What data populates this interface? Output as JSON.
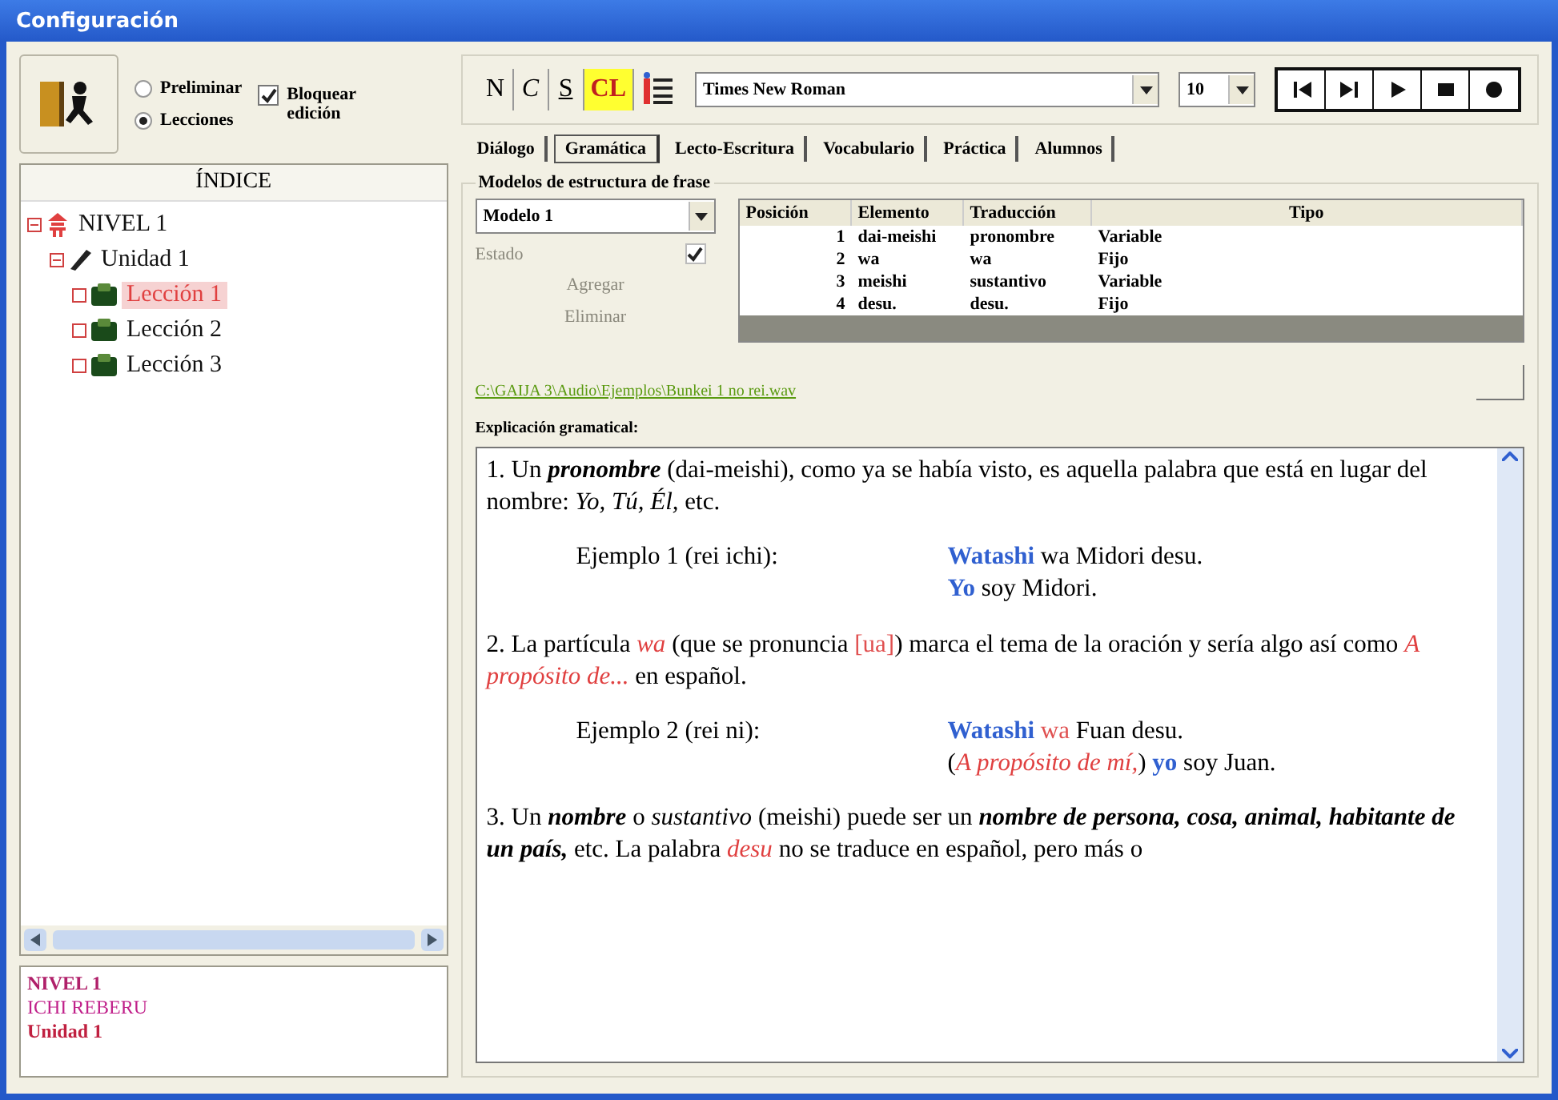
{
  "window": {
    "title": "Configuración"
  },
  "mode_options": [
    {
      "label": "Preliminar",
      "selected": false
    },
    {
      "label": "Lecciones",
      "selected": true
    }
  ],
  "lock_edit": {
    "label": "Bloquear edición",
    "checked": true
  },
  "index": {
    "title": "ÍNDICE",
    "tree": [
      {
        "label": "NIVEL 1",
        "kind": "level",
        "expanded": true,
        "selected": false,
        "children": [
          {
            "label": "Unidad 1",
            "kind": "unit",
            "expanded": true,
            "selected": false,
            "children": [
              {
                "label": "Lección 1",
                "kind": "lesson",
                "selected": true
              },
              {
                "label": "Lección 2",
                "kind": "lesson",
                "selected": false
              },
              {
                "label": "Lección 3",
                "kind": "lesson",
                "selected": false
              }
            ]
          }
        ]
      }
    ]
  },
  "info_box": [
    {
      "text": "NIVEL 1",
      "kind": "level"
    },
    {
      "text": "ICHI REBERU",
      "kind": "reading"
    },
    {
      "text": "Unidad 1",
      "kind": "unit"
    }
  ],
  "format_buttons": [
    {
      "label": "N",
      "kind": "bold",
      "active": false
    },
    {
      "label": "C",
      "kind": "italic",
      "active": false
    },
    {
      "label": "S",
      "kind": "underline",
      "active": false
    },
    {
      "label": "CL",
      "kind": "color",
      "active": true
    }
  ],
  "font": {
    "value": "Times New Roman"
  },
  "size": {
    "value": "10"
  },
  "media_buttons": [
    {
      "kind": "first"
    },
    {
      "kind": "next"
    },
    {
      "kind": "play"
    },
    {
      "kind": "stop"
    },
    {
      "kind": "record"
    }
  ],
  "tabs": [
    {
      "label": "Diálogo",
      "selected": false
    },
    {
      "label": "Gramática",
      "selected": true
    },
    {
      "label": "Lecto-Escritura",
      "selected": false
    },
    {
      "label": "Vocabulario",
      "selected": false
    },
    {
      "label": "Práctica",
      "selected": false
    },
    {
      "label": "Alumnos",
      "selected": false
    }
  ],
  "models": {
    "title": "Modelos de estructura de frase",
    "model": "Modelo 1",
    "state": {
      "label": "Estado",
      "checked": true,
      "disabled": true
    },
    "buttons": [
      {
        "label": "Agregar",
        "disabled": true
      },
      {
        "label": "Eliminar",
        "disabled": true
      }
    ],
    "columns": [
      "Posición",
      "Elemento",
      "Traducción",
      "Tipo"
    ],
    "rows": [
      [
        "1",
        "dai-meishi",
        "pronombre",
        "Variable"
      ],
      [
        "2",
        "wa",
        "wa",
        "Fijo"
      ],
      [
        "3",
        "meishi",
        "sustantivo",
        "Variable"
      ],
      [
        "4",
        "desu.",
        "desu.",
        "Fijo"
      ]
    ]
  },
  "audio_path": "C:\\GAIJA 3\\Audio\\Ejemplos\\Bunkei 1 no rei.wav",
  "explanation": {
    "label": "Explicación gramatical:",
    "blocks": [
      {
        "kind": "para",
        "segments": [
          {
            "kind": "plain",
            "text": "1. Un "
          },
          {
            "kind": "emph",
            "text": "pronombre"
          },
          {
            "kind": "plain",
            "text": " (dai-meishi), como ya se había visto, es aquella palabra que está en lugar del nombre: "
          },
          {
            "kind": "italic",
            "text": "Yo, Tú, Él,"
          },
          {
            "kind": "plain",
            "text": " etc."
          }
        ]
      },
      {
        "kind": "example",
        "label": "Ejemplo 1 (rei ichi):",
        "lines": [
          [
            {
              "kind": "jp",
              "text": "Watashi"
            },
            {
              "kind": "plain",
              "text": " wa Midori desu."
            }
          ],
          [
            {
              "kind": "jp",
              "text": "Yo"
            },
            {
              "kind": "plain",
              "text": " soy Midori."
            }
          ]
        ]
      },
      {
        "kind": "para",
        "segments": [
          {
            "kind": "plain",
            "text": "2. La partícula "
          },
          {
            "kind": "term",
            "text": "wa"
          },
          {
            "kind": "plain",
            "text": " (que se pronuncia "
          },
          {
            "kind": "note",
            "text": "[ua]"
          },
          {
            "kind": "plain",
            "text": ") marca el tema de la oración y sería algo así como "
          },
          {
            "kind": "term",
            "text": "A propósito de..."
          },
          {
            "kind": "plain",
            "text": " en español."
          }
        ]
      },
      {
        "kind": "example",
        "label": "Ejemplo 2 (rei ni):",
        "lines": [
          [
            {
              "kind": "jp",
              "text": "Watashi"
            },
            {
              "kind": "note",
              "text": " wa"
            },
            {
              "kind": "plain",
              "text": " Fuan desu."
            }
          ],
          [
            {
              "kind": "plain",
              "text": "("
            },
            {
              "kind": "term",
              "text": "A propósito de mí,"
            },
            {
              "kind": "plain",
              "text": ") "
            },
            {
              "kind": "jp",
              "text": "yo"
            },
            {
              "kind": "plain",
              "text": " soy Juan."
            }
          ]
        ]
      },
      {
        "kind": "para",
        "segments": [
          {
            "kind": "plain",
            "text": "3. Un "
          },
          {
            "kind": "emph",
            "text": "nombre"
          },
          {
            "kind": "plain",
            "text": " o "
          },
          {
            "kind": "italic",
            "text": "sustantivo"
          },
          {
            "kind": "plain",
            "text": " (meishi) puede ser un "
          },
          {
            "kind": "emph",
            "text": "nombre de persona, cosa, animal, habitante de un país,"
          },
          {
            "kind": "plain",
            "text": " etc. La palabra "
          },
          {
            "kind": "term",
            "text": "desu"
          },
          {
            "kind": "plain",
            "text": " no se traduce en español, pero más o"
          }
        ]
      }
    ]
  }
}
